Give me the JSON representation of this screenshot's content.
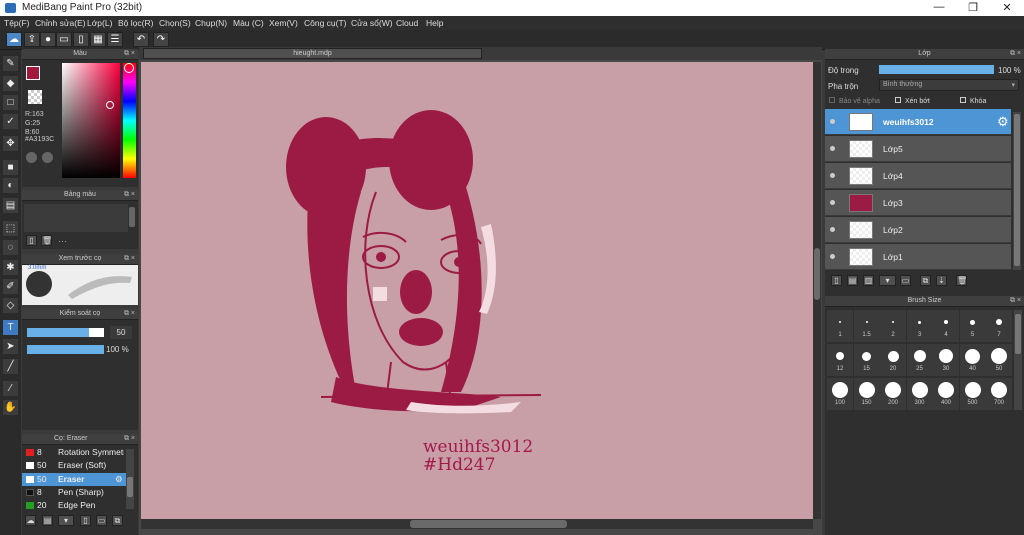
{
  "window": {
    "title": "MediBang Paint Pro (32bit)",
    "min": "—",
    "max": "❐",
    "close": "✕"
  },
  "menu": [
    "Tệp(F)",
    "Chỉnh sửa(E)",
    "Lớp(L)",
    "Bộ lọc(R)",
    "Chọn(S)",
    "Chụp(N)",
    "Màu (C)",
    "Xem(V)",
    "Công cụ(T)",
    "Cửa sổ(W)",
    "Cloud",
    "Help"
  ],
  "color_panel": {
    "title": "Màu",
    "r": "R:163",
    "g": "G:25",
    "b": "B:60",
    "hex": "#A3193C",
    "primary": "#A3193C"
  },
  "palette_panel": {
    "title": "Bảng màu",
    "menu_text": "···"
  },
  "brush_preview": {
    "title": "Xem trước cọ",
    "size_text": "3.0mm"
  },
  "brush_control": {
    "title": "Kiểm soát cọ",
    "size": "50",
    "opacity": "100 %",
    "size_fill": 0.8,
    "opacity_fill": 1.0
  },
  "brush_list": {
    "title": "Cọ: Eraser",
    "items": [
      {
        "size": "8",
        "label": "Rotation Symmetry",
        "color": "#e02020"
      },
      {
        "size": "50",
        "label": "Eraser (Soft)",
        "color": "#ffffff"
      },
      {
        "size": "50",
        "label": "Eraser",
        "color": "#ffffff"
      },
      {
        "size": "8",
        "label": "Pen (Sharp)",
        "color": "#111111"
      },
      {
        "size": "20",
        "label": "Edge Pen",
        "color": "#22a022"
      }
    ]
  },
  "document": {
    "tab": "hieught.mdp"
  },
  "signature": {
    "line1": "weuihfs3012",
    "line2": "#Hd247"
  },
  "layer_panel": {
    "title": "Lớp",
    "opacity_label": "Độ trong",
    "opacity_value": "100 %",
    "blend_label": "Pha trộn",
    "blend_value": "Bình thường",
    "protect_alpha": "Bảo vệ alpha",
    "clipping": "Xén bớt",
    "lock": "Khóa",
    "layers": [
      "weuihfs3012",
      "Lớp5",
      "Lớp4",
      "Lớp3",
      "Lớp2",
      "Lớp1"
    ]
  },
  "brush_size_panel": {
    "title": "Brush Size",
    "sizes": [
      "1",
      "1.5",
      "2",
      "3",
      "4",
      "5",
      "7",
      "12",
      "15",
      "20",
      "25",
      "30",
      "40",
      "50",
      "100",
      "150",
      "200",
      "300",
      "400",
      "500",
      "700"
    ]
  }
}
